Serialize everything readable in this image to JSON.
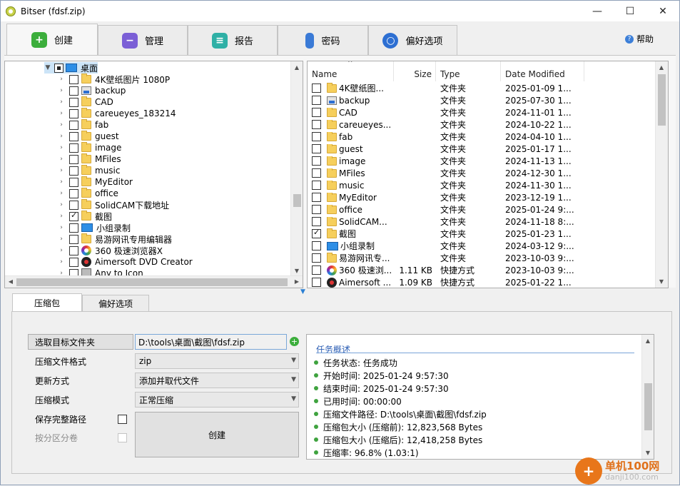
{
  "window": {
    "title": "Bitser (fdsf.zip)",
    "minimize": "—",
    "maximize": "☐",
    "close": "✕"
  },
  "main_tabs": [
    {
      "label": "创建",
      "icon": "create-icon",
      "color": "#3cae3c"
    },
    {
      "label": "管理",
      "icon": "manage-icon",
      "color": "#7b5fd6"
    },
    {
      "label": "报告",
      "icon": "report-icon",
      "color": "#2fb0a6"
    },
    {
      "label": "密码",
      "icon": "key-icon",
      "color": "#3a7ad6"
    },
    {
      "label": "偏好选项",
      "icon": "preferences-icon",
      "color": "#2d6fd2"
    }
  ],
  "help_label": "帮助",
  "tree": {
    "root_label": "桌面",
    "items": [
      {
        "label": "4K壁纸图片 1080P",
        "icon": "folder",
        "checked": false
      },
      {
        "label": "backup",
        "icon": "network",
        "checked": false
      },
      {
        "label": "CAD",
        "icon": "folder",
        "checked": false
      },
      {
        "label": "careueyes_183214",
        "icon": "folder",
        "checked": false
      },
      {
        "label": "fab",
        "icon": "folder",
        "checked": false
      },
      {
        "label": "guest",
        "icon": "folder",
        "checked": false
      },
      {
        "label": "image",
        "icon": "folder",
        "checked": false
      },
      {
        "label": "MFiles",
        "icon": "folder",
        "checked": false
      },
      {
        "label": "music",
        "icon": "folder",
        "checked": false
      },
      {
        "label": "MyEditor",
        "icon": "folder",
        "checked": false
      },
      {
        "label": "office",
        "icon": "folder",
        "checked": false
      },
      {
        "label": "SolidCAM下载地址",
        "icon": "folder",
        "checked": false
      },
      {
        "label": "截图",
        "icon": "folder",
        "checked": true
      },
      {
        "label": "小组录制",
        "icon": "desktop",
        "checked": false
      },
      {
        "label": "易游网讯专用编辑器",
        "icon": "folder",
        "checked": false
      },
      {
        "label": "360 极速浏览器X",
        "icon": "360",
        "checked": false
      },
      {
        "label": "Aimersoft DVD Creator",
        "icon": "aimersoft",
        "checked": false
      },
      {
        "label": "Any to Icon",
        "icon": "generic",
        "checked": false
      }
    ]
  },
  "file_list": {
    "headers": {
      "name": "Name",
      "size": "Size",
      "type": "Type",
      "date": "Date Modified"
    },
    "rows": [
      {
        "name": "4K壁纸图...",
        "size": "",
        "type": "文件夹",
        "date": "2025-01-09 1...",
        "icon": "folder",
        "checked": false
      },
      {
        "name": "backup",
        "size": "",
        "type": "文件夹",
        "date": "2025-07-30 1...",
        "icon": "network",
        "checked": false
      },
      {
        "name": "CAD",
        "size": "",
        "type": "文件夹",
        "date": "2024-11-01 1...",
        "icon": "folder",
        "checked": false
      },
      {
        "name": "careueyes...",
        "size": "",
        "type": "文件夹",
        "date": "2024-10-22 1...",
        "icon": "folder",
        "checked": false
      },
      {
        "name": "fab",
        "size": "",
        "type": "文件夹",
        "date": "2024-04-10 1...",
        "icon": "folder",
        "checked": false
      },
      {
        "name": "guest",
        "size": "",
        "type": "文件夹",
        "date": "2025-01-17 1...",
        "icon": "folder",
        "checked": false
      },
      {
        "name": "image",
        "size": "",
        "type": "文件夹",
        "date": "2024-11-13 1...",
        "icon": "folder",
        "checked": false
      },
      {
        "name": "MFiles",
        "size": "",
        "type": "文件夹",
        "date": "2024-12-30 1...",
        "icon": "folder",
        "checked": false
      },
      {
        "name": "music",
        "size": "",
        "type": "文件夹",
        "date": "2024-11-30 1...",
        "icon": "folder",
        "checked": false
      },
      {
        "name": "MyEditor",
        "size": "",
        "type": "文件夹",
        "date": "2023-12-19 1...",
        "icon": "folder",
        "checked": false
      },
      {
        "name": "office",
        "size": "",
        "type": "文件夹",
        "date": "2025-01-24 9:...",
        "icon": "folder",
        "checked": false
      },
      {
        "name": "SolidCAM...",
        "size": "",
        "type": "文件夹",
        "date": "2024-11-18 8:...",
        "icon": "folder",
        "checked": false
      },
      {
        "name": "截图",
        "size": "",
        "type": "文件夹",
        "date": "2025-01-23 1...",
        "icon": "folder",
        "checked": true
      },
      {
        "name": "小组录制",
        "size": "",
        "type": "文件夹",
        "date": "2024-03-12 9:...",
        "icon": "desktop",
        "checked": false
      },
      {
        "name": "易游网讯专...",
        "size": "",
        "type": "文件夹",
        "date": "2023-10-03 9:...",
        "icon": "folder",
        "checked": false
      },
      {
        "name": "360 极速浏...",
        "size": "1.11 KB",
        "type": "快捷方式",
        "date": "2023-10-03 9:...",
        "icon": "360",
        "checked": false
      },
      {
        "name": "Aimersoft ...",
        "size": "1.09 KB",
        "type": "快捷方式",
        "date": "2025-01-22 1...",
        "icon": "aimersoft",
        "checked": false
      }
    ]
  },
  "bottom_tabs": [
    "压缩包",
    "偏好选项"
  ],
  "form": {
    "target_button": "选取目标文件夹",
    "target_path": "D:\\tools\\桌面\\截图\\fdsf.zip",
    "format_label": "压缩文件格式",
    "format_value": "zip",
    "update_label": "更新方式",
    "update_value": "添加并取代文件",
    "mode_label": "压缩模式",
    "mode_value": "正常压缩",
    "keep_path_label": "保存完整路径",
    "split_label": "按分区分卷",
    "create_button": "创建"
  },
  "summary": {
    "header": "任务概述",
    "items": [
      "任务状态: 任务成功",
      "开始时间: 2025-01-24 9:57:30",
      "结束时间: 2025-01-24 9:57:30",
      "已用时间: 00:00:00",
      "压缩文件路径: D:\\tools\\桌面\\截图\\fdsf.zip",
      "压缩包大小 (压缩前): 12,823,568 Bytes",
      "压缩包大小 (压缩后): 12,418,258 Bytes",
      "压缩率: 96.8% (1.03:1)"
    ]
  },
  "watermark": {
    "line1": "单机100网",
    "line2": "danji100.com"
  }
}
